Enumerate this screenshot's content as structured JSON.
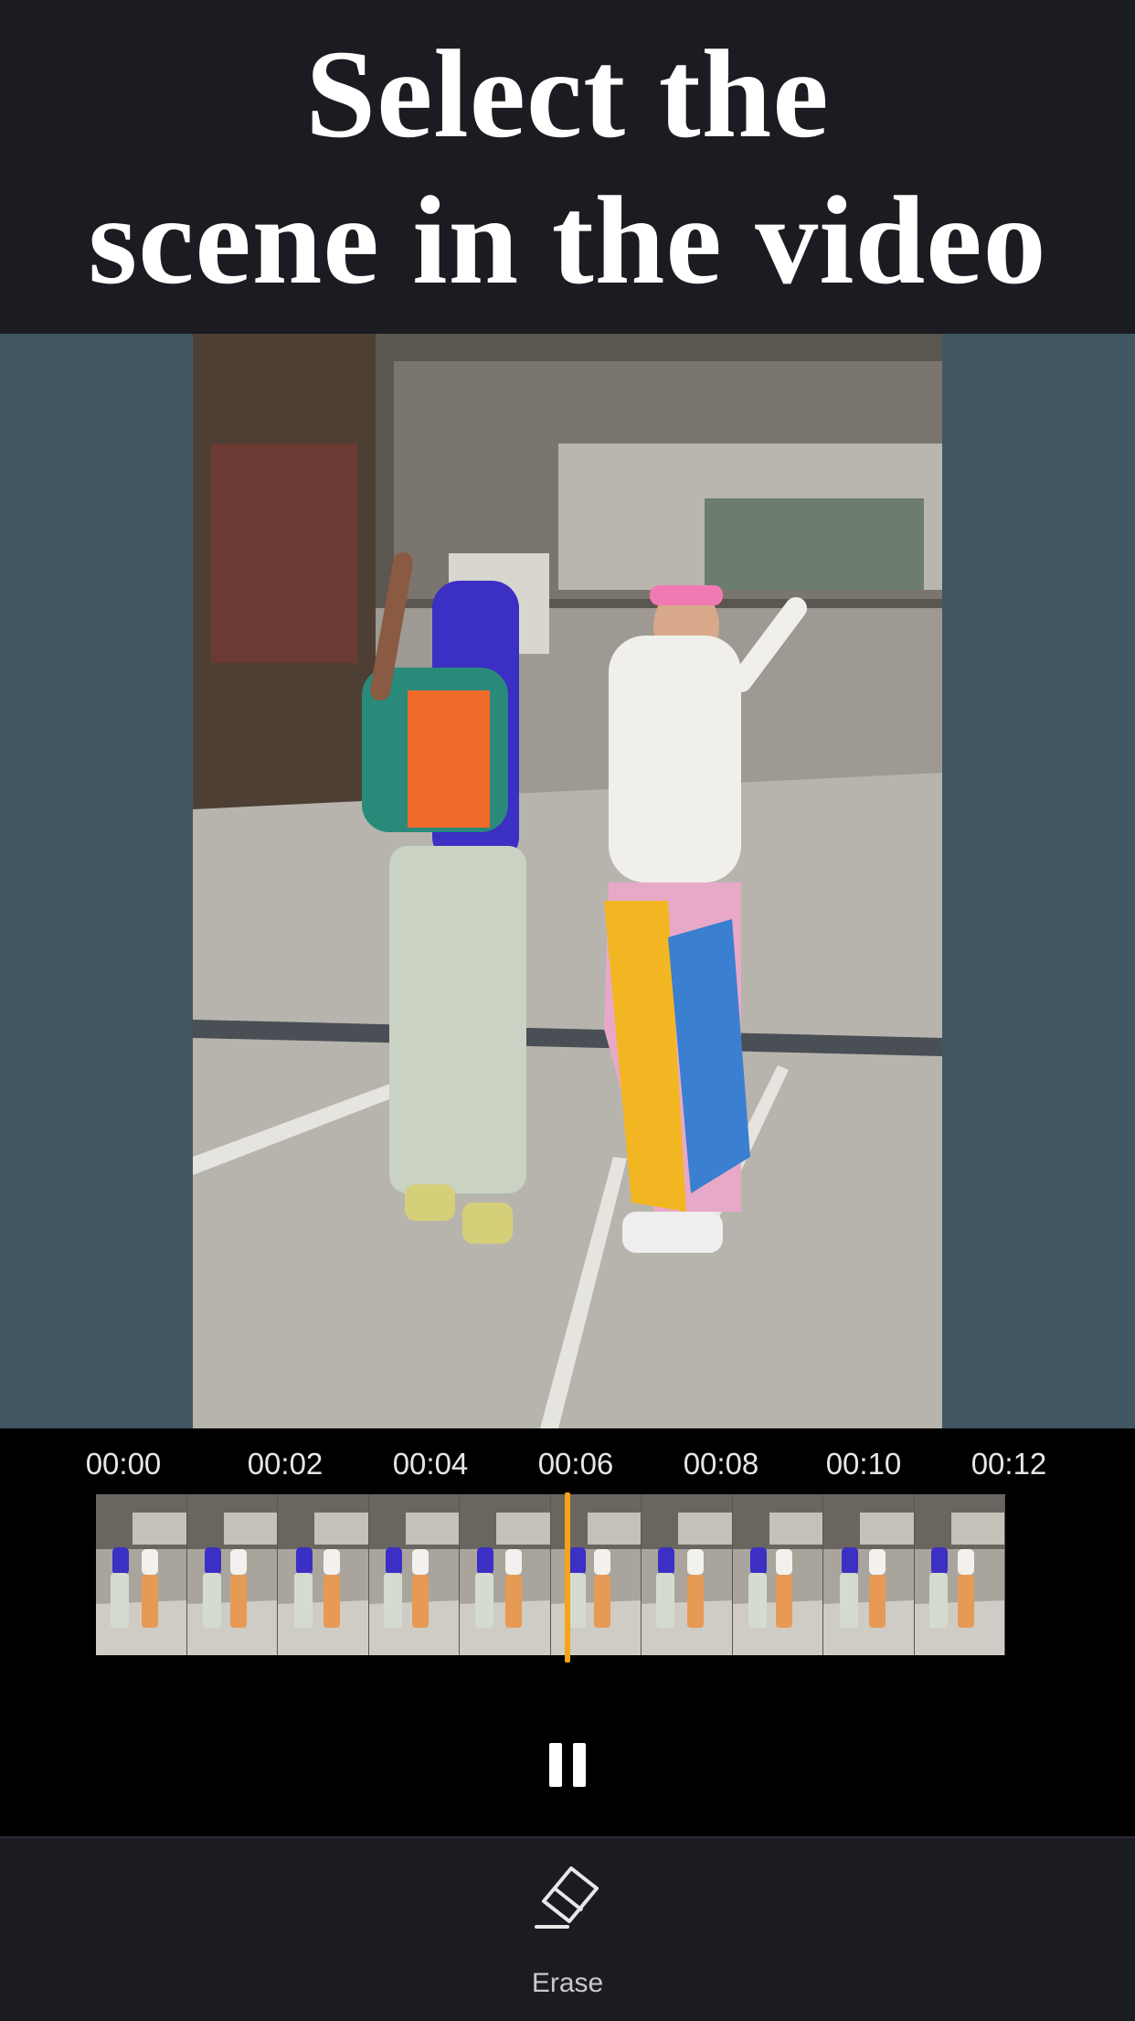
{
  "header": {
    "title_line1": "Select the",
    "title_line2": "scene in the video"
  },
  "video": {
    "description_icon": "video-preview"
  },
  "timeline": {
    "timecodes": [
      "00:00",
      "00:02",
      "00:04",
      "00:06",
      "00:08",
      "00:10",
      "00:12"
    ],
    "frame_count": 10,
    "playhead_color": "#f5a31a",
    "playback_state": "playing",
    "pause_icon": "pause-icon"
  },
  "toolbar": {
    "erase_label": "Erase",
    "erase_icon": "eraser-icon"
  },
  "colors": {
    "header_bg": "#1b1c21",
    "stage_bg": "#405662",
    "accent": "#f5a31a"
  }
}
